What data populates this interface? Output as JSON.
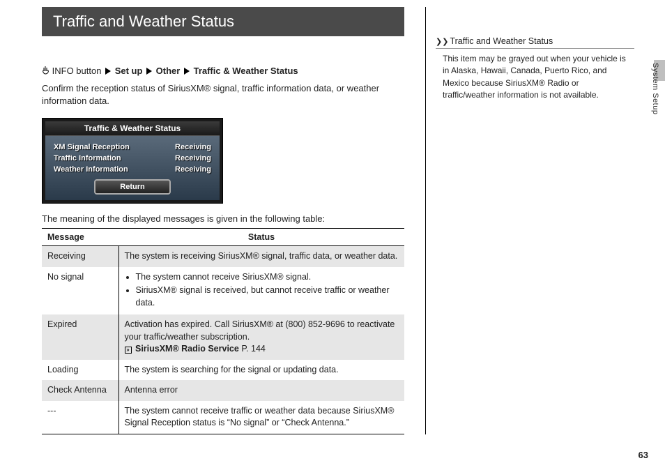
{
  "header": {
    "title": "Traffic and Weather Status"
  },
  "breadcrumb": {
    "prefix": "INFO button",
    "steps": [
      "Set up",
      "Other",
      "Traffic & Weather Status"
    ]
  },
  "intro": "Confirm the reception status of SiriusXM® signal, traffic information data, or weather information data.",
  "screen": {
    "title": "Traffic & Weather Status",
    "rows": [
      {
        "label": "XM Signal Reception",
        "status": "Receiving"
      },
      {
        "label": "Traffic Information",
        "status": "Receiving"
      },
      {
        "label": "Weather Information",
        "status": "Receiving"
      }
    ],
    "return": "Return"
  },
  "caption": "The meaning of the displayed messages is given in the following table:",
  "table": {
    "col_message": "Message",
    "col_status": "Status",
    "rows": [
      {
        "message": "Receiving",
        "status_type": "text",
        "status": "The system is receiving SiriusXM® signal, traffic data, or weather data."
      },
      {
        "message": "No signal",
        "status_type": "bullets",
        "bullets": [
          "The system cannot receive SiriusXM® signal.",
          "SiriusXM® signal is received, but cannot receive traffic or weather data."
        ]
      },
      {
        "message": "Expired",
        "status_type": "expired",
        "status": "Activation has expired. Call SiriusXM® at (800) 852-9696 to reactivate your traffic/weather subscription.",
        "ref_label": "SiriusXM® Radio Service",
        "ref_page": "P. 144"
      },
      {
        "message": "Loading",
        "status_type": "text",
        "status": "The system is searching for the signal or updating data."
      },
      {
        "message": "Check Antenna",
        "status_type": "text",
        "status": "Antenna error"
      },
      {
        "message": "---",
        "status_type": "text",
        "status": "The system cannot receive traffic or weather data because SiriusXM® Signal Reception status is “No signal” or “Check Antenna.”"
      }
    ]
  },
  "sidebar": {
    "head": "Traffic and Weather Status",
    "body": "This item may be grayed out when your vehicle is in Alaska, Hawaii, Canada, Puerto Rico, and Mexico because SiriusXM® Radio or traffic/weather information is not available."
  },
  "side_tab": "System Setup",
  "page_number": "63"
}
